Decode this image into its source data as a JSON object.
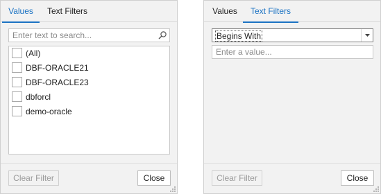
{
  "accent_color": "#1a72c3",
  "left_panel": {
    "tabs": [
      {
        "label": "Values",
        "active": true
      },
      {
        "label": "Text Filters",
        "active": false
      }
    ],
    "search": {
      "placeholder": "Enter text to search...",
      "value": "",
      "icon": "search-icon"
    },
    "items": [
      {
        "label": "(All)",
        "checked": false
      },
      {
        "label": "DBF-ORACLE21",
        "checked": false
      },
      {
        "label": "DBF-ORACLE23",
        "checked": false
      },
      {
        "label": "dbforcl",
        "checked": false
      },
      {
        "label": "demo-oracle",
        "checked": false
      }
    ],
    "buttons": {
      "clear": "Clear Filter",
      "close": "Close"
    }
  },
  "right_panel": {
    "tabs": [
      {
        "label": "Values",
        "active": false
      },
      {
        "label": "Text Filters",
        "active": true
      }
    ],
    "operator": {
      "selected": "Begins With"
    },
    "value_input": {
      "placeholder": "Enter a value...",
      "value": ""
    },
    "buttons": {
      "clear": "Clear Filter",
      "close": "Close"
    }
  }
}
